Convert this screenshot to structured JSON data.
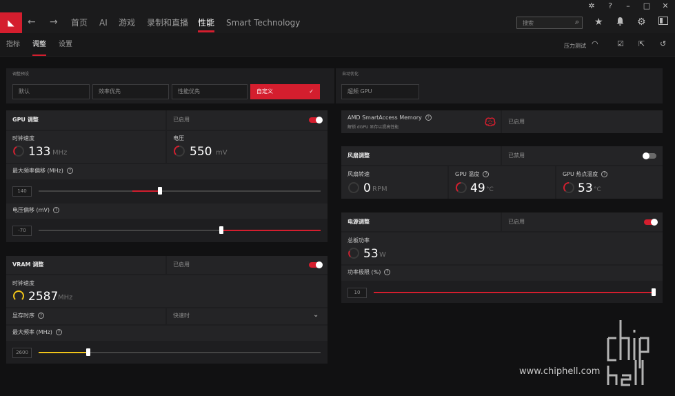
{
  "nav": {
    "items": [
      "首页",
      "AI",
      "游戏",
      "录制和直播",
      "性能",
      "Smart Technology"
    ],
    "search_placeholder": "搜索"
  },
  "subnav": {
    "items": [
      "指标",
      "调整",
      "设置"
    ],
    "stress_test": "压力测试"
  },
  "tuning": {
    "preset_label": "调整预设",
    "presets": [
      "默认",
      "效率优先",
      "性能优先",
      "自定义"
    ],
    "auto_label": "自动优化",
    "auto_button": "超频 GPU"
  },
  "gpu": {
    "title": "GPU 调整",
    "status": "已启用",
    "clock_label": "时钟速度",
    "clock_value": "133",
    "clock_unit": "MHz",
    "voltage_label": "电压",
    "voltage_value": "550",
    "voltage_unit": "mV",
    "max_freq_offset_label": "最大频率偏移 (MHz)",
    "max_freq_offset_value": "140",
    "voltage_offset_label": "电压偏移 (mV)",
    "voltage_offset_value": "-70"
  },
  "vram": {
    "title": "VRAM 调整",
    "status": "已启用",
    "clock_label": "时钟速度",
    "clock_value": "2587",
    "clock_unit": "MHz",
    "timing_label": "显存时序",
    "timing_value": "快速时",
    "max_freq_label": "最大频率 (MHz)",
    "max_freq_value": "2600"
  },
  "sam": {
    "title": "AMD SmartAccess Memory",
    "desc": "解锁 dGPU 显存以提高性能",
    "status": "已启用"
  },
  "fan": {
    "title": "风扇调整",
    "status": "已禁用",
    "speed_label": "风扇转速",
    "speed_value": "0",
    "speed_unit": "RPM",
    "temp_label": "GPU 温度",
    "temp_value": "49",
    "temp_unit": "°C",
    "hotspot_label": "GPU 热点温度",
    "hotspot_value": "53",
    "hotspot_unit": "°C"
  },
  "power": {
    "title": "电源调整",
    "status": "已启用",
    "board_label": "总板功率",
    "board_value": "53",
    "board_unit": "W",
    "limit_label": "功率极限 (%)",
    "limit_value": "10"
  },
  "watermark": "www.chiphell.com",
  "colors": {
    "accent": "#d41e2e",
    "vram_accent": "#f0c419",
    "panel": "#1e1e20",
    "background": "#111112"
  }
}
